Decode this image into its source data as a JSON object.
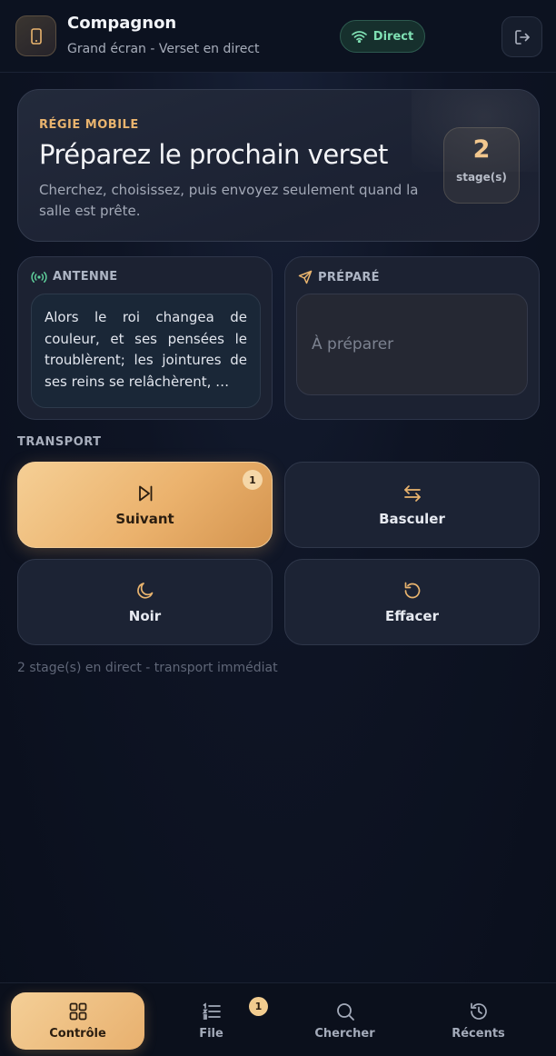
{
  "header": {
    "title": "Compagnon",
    "subtitle": "Grand écran - Verset en direct",
    "live_badge": "Direct",
    "app_icon": "phone-icon",
    "logout_icon": "logout-icon"
  },
  "hero": {
    "kicker": "RÉGIE MOBILE",
    "title": "Préparez le prochain verset",
    "description": "Cherchez, choisissez, puis envoyez seulement quand la salle est prête.",
    "stage_count": "2",
    "stage_label": "stage(s)"
  },
  "on_air": {
    "label": "ANTENNE",
    "icon": "broadcast-icon",
    "verse": "Alors le roi changea de couleur, et ses pensées le troublèrent; les jointures de ses reins se relâchèrent, …"
  },
  "prepared": {
    "label": "PRÉPARÉ",
    "icon": "send-icon",
    "placeholder": "À préparer"
  },
  "transport": {
    "section_label": "TRANSPORT",
    "next": {
      "label": "Suivant",
      "badge": "1",
      "icon": "skip-next-icon"
    },
    "toggle": {
      "label": "Basculer",
      "icon": "swap-icon"
    },
    "black": {
      "label": "Noir",
      "icon": "moon-icon"
    },
    "clear": {
      "label": "Effacer",
      "icon": "reset-icon"
    },
    "status": "2 stage(s) en direct - transport immédiat"
  },
  "nav": {
    "items": [
      {
        "label": "Contrôle",
        "icon": "grid-icon",
        "active": true
      },
      {
        "label": "File",
        "icon": "list-icon",
        "badge": "1"
      },
      {
        "label": "Chercher",
        "icon": "search-icon"
      },
      {
        "label": "Récents",
        "icon": "history-icon"
      }
    ]
  },
  "colors": {
    "accent": "#ebb26d",
    "live_green": "#7fe0b3",
    "background": "#0e1424"
  }
}
